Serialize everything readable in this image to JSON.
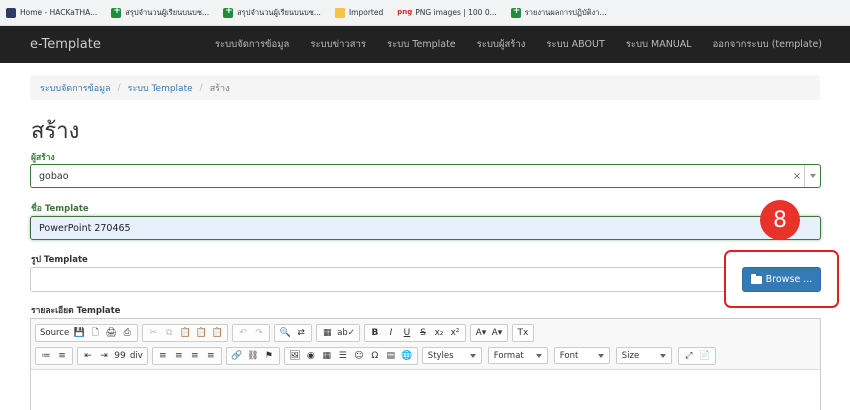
{
  "bookmarks": [
    {
      "label": "Home - HACKaTHA...",
      "icon": "site-icon"
    },
    {
      "label": "สรุปจำนวนผู้เรียนบนบช...",
      "icon": "sheets-icon"
    },
    {
      "label": "สรุปจำนวนผู้เรียนบนบช...",
      "icon": "sheets-icon"
    },
    {
      "label": "Imported",
      "icon": "folder-icon"
    },
    {
      "label": "PNG images | 100 0...",
      "icon": "png-icon",
      "badge": "png"
    },
    {
      "label": "รายงานผลการปฏิบัติงา...",
      "icon": "sheets-icon"
    }
  ],
  "navbar": {
    "brand": "e-Template",
    "items": [
      "ระบบจัดการข้อมูล",
      "ระบบข่าวสาร",
      "ระบบ Template",
      "ระบบผู้สร้าง",
      "ระบบ ABOUT",
      "ระบบ MANUAL",
      "ออกจากระบบ (template)"
    ]
  },
  "breadcrumb": {
    "items": [
      "ระบบจัดการข้อมูล",
      "ระบบ Template"
    ],
    "active": "สร้าง",
    "separator": "/"
  },
  "page_title": "สร้าง",
  "form": {
    "creator_label": "ผู้สร้าง",
    "creator_value": "gobao",
    "clear_symbol": "×",
    "name_label": "ชื่อ Template",
    "name_value": "PowerPoint 270465",
    "image_label": "รูป Template",
    "browse_label": "Browse ...",
    "detail_label": "รายละเอียด Template"
  },
  "annotation": {
    "step": "8",
    "color": "#e02020"
  },
  "editor": {
    "row1": [
      [
        "Source",
        "💾",
        "🗋",
        "🖨",
        "⎙"
      ],
      [
        "✂",
        "⧉",
        "📋",
        "📋",
        "📋"
      ],
      [
        "↶",
        "↷"
      ],
      [
        "🔍",
        "⇄"
      ],
      [
        "▦",
        "ab✓"
      ],
      [
        "B",
        "I",
        "U",
        "S",
        "x₂",
        "x²"
      ],
      [
        "A▾",
        "A▾"
      ],
      [
        "Tx"
      ]
    ],
    "row2": [
      [
        "≔",
        "≡"
      ],
      [
        "⇤",
        "⇥",
        "99",
        "div"
      ],
      [
        "≡",
        "≡",
        "≡",
        "≡"
      ],
      [
        "🔗",
        "⛓",
        "⚑"
      ],
      [
        "🖼",
        "◉",
        "▦",
        "☰",
        "☺",
        "Ω",
        "▤",
        "🌐"
      ]
    ],
    "combos": [
      "Styles",
      "Format",
      "Font",
      "Size"
    ],
    "row2_tail": [
      "⤢",
      "📄"
    ]
  },
  "colors": {
    "navbar": "#222222",
    "primary": "#337ab7",
    "success": "#3c763d"
  }
}
